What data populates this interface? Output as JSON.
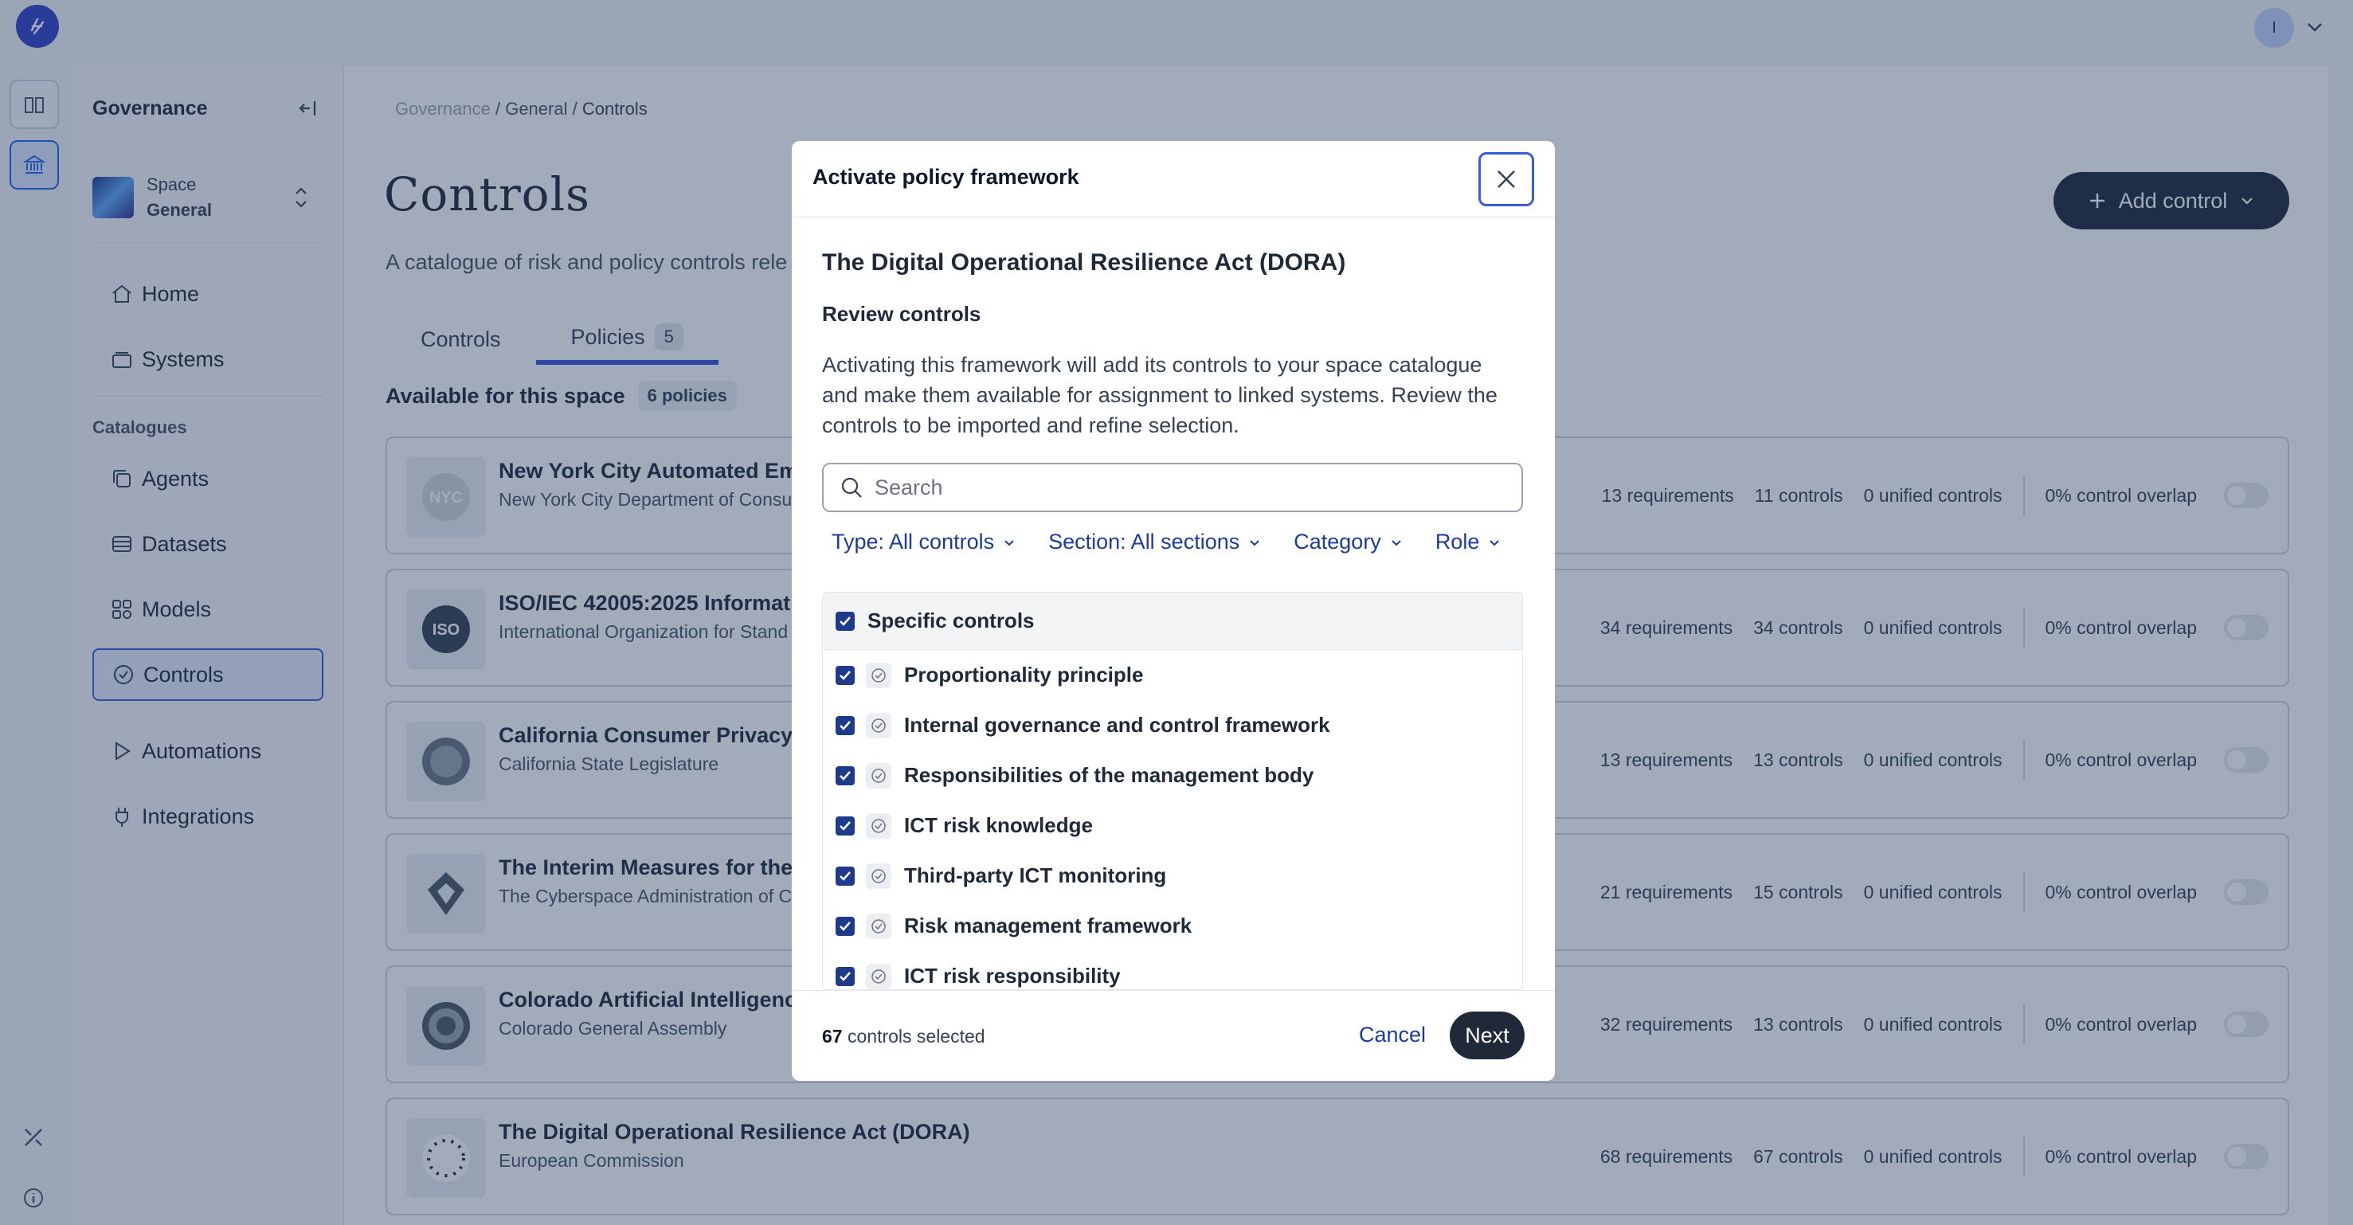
{
  "header": {
    "user_initial": "I"
  },
  "sidebar": {
    "title": "Governance",
    "space": {
      "label": "Space",
      "name": "General"
    },
    "items": [
      {
        "label": "Home",
        "icon": "home-icon"
      },
      {
        "label": "Systems",
        "icon": "systems-icon"
      }
    ],
    "section_label": "Catalogues",
    "catalogue_items": [
      {
        "label": "Agents",
        "icon": "agents-icon"
      },
      {
        "label": "Datasets",
        "icon": "datasets-icon"
      },
      {
        "label": "Models",
        "icon": "models-icon"
      },
      {
        "label": "Controls",
        "icon": "controls-icon"
      }
    ],
    "extra_items": [
      {
        "label": "Automations",
        "icon": "play-icon"
      },
      {
        "label": "Integrations",
        "icon": "plug-icon"
      }
    ]
  },
  "breadcrumb": {
    "root": "Governance",
    "sep1": " / ",
    "space": "General",
    "sep2": " / ",
    "current": "Controls"
  },
  "page": {
    "title": "Controls",
    "subtitle": "A catalogue of risk and policy controls rele",
    "add_button": "Add control"
  },
  "tabs": [
    {
      "label": "Controls"
    },
    {
      "label": "Policies",
      "badge": "5"
    }
  ],
  "available": {
    "label": "Available for this space",
    "count": "6 policies"
  },
  "policies": [
    {
      "name": "New York City Automated Emp",
      "org": "New York City Department of Consu",
      "requirements": "13 requirements",
      "controls": "11 controls",
      "unified": "0 unified controls",
      "overlap": "0% control overlap",
      "logo": "NYC"
    },
    {
      "name": "ISO/IEC 42005:2025 Informatio",
      "org": "International Organization for Stand",
      "requirements": "34 requirements",
      "controls": "34 controls",
      "unified": "0 unified controls",
      "overlap": "0% control overlap",
      "logo": "ISO"
    },
    {
      "name": "California Consumer Privacy A",
      "org": "California State Legislature",
      "requirements": "13 requirements",
      "controls": "13 controls",
      "unified": "0 unified controls",
      "overlap": "0% control overlap",
      "logo": ""
    },
    {
      "name": "The Interim Measures for the M",
      "org": "The Cyberspace Administration of C",
      "requirements": "21 requirements",
      "controls": "15 controls",
      "unified": "0 unified controls",
      "overlap": "0% control overlap",
      "logo": ""
    },
    {
      "name": "Colorado Artificial Intelligence",
      "org": "Colorado General Assembly",
      "requirements": "32 requirements",
      "controls": "13 controls",
      "unified": "0 unified controls",
      "overlap": "0% control overlap",
      "logo": ""
    },
    {
      "name": "The Digital Operational Resilience Act (DORA)",
      "org": "European Commission",
      "requirements": "68 requirements",
      "controls": "67 controls",
      "unified": "0 unified controls",
      "overlap": "0% control overlap",
      "logo": ""
    }
  ],
  "modal": {
    "title": "Activate policy framework",
    "framework": "The Digital Operational Resilience Act (DORA)",
    "review_heading": "Review controls",
    "description": "Activating this framework will add its controls to your space catalogue and make them available for assignment to linked systems. Review the controls to be imported and refine selection.",
    "search_placeholder": "Search",
    "filters": [
      {
        "label": "Type: All controls"
      },
      {
        "label": "Section: All sections"
      },
      {
        "label": "Category"
      },
      {
        "label": "Role"
      }
    ],
    "group_label": "Specific controls",
    "rows": [
      {
        "label": "Proportionality principle"
      },
      {
        "label": "Internal governance and control framework"
      },
      {
        "label": "Responsibilities of the management body"
      },
      {
        "label": "ICT risk knowledge"
      },
      {
        "label": "Third-party ICT monitoring"
      },
      {
        "label": "Risk management framework"
      },
      {
        "label": "ICT risk responsibility"
      }
    ],
    "selected_count": "67",
    "selected_suffix": " controls selected",
    "cancel": "Cancel",
    "next": "Next"
  },
  "colors": {
    "accent": "#3b5bdb",
    "dark_button": "#1f2937",
    "checkbox": "#1e3a8a",
    "overlay": "#1e375a"
  }
}
